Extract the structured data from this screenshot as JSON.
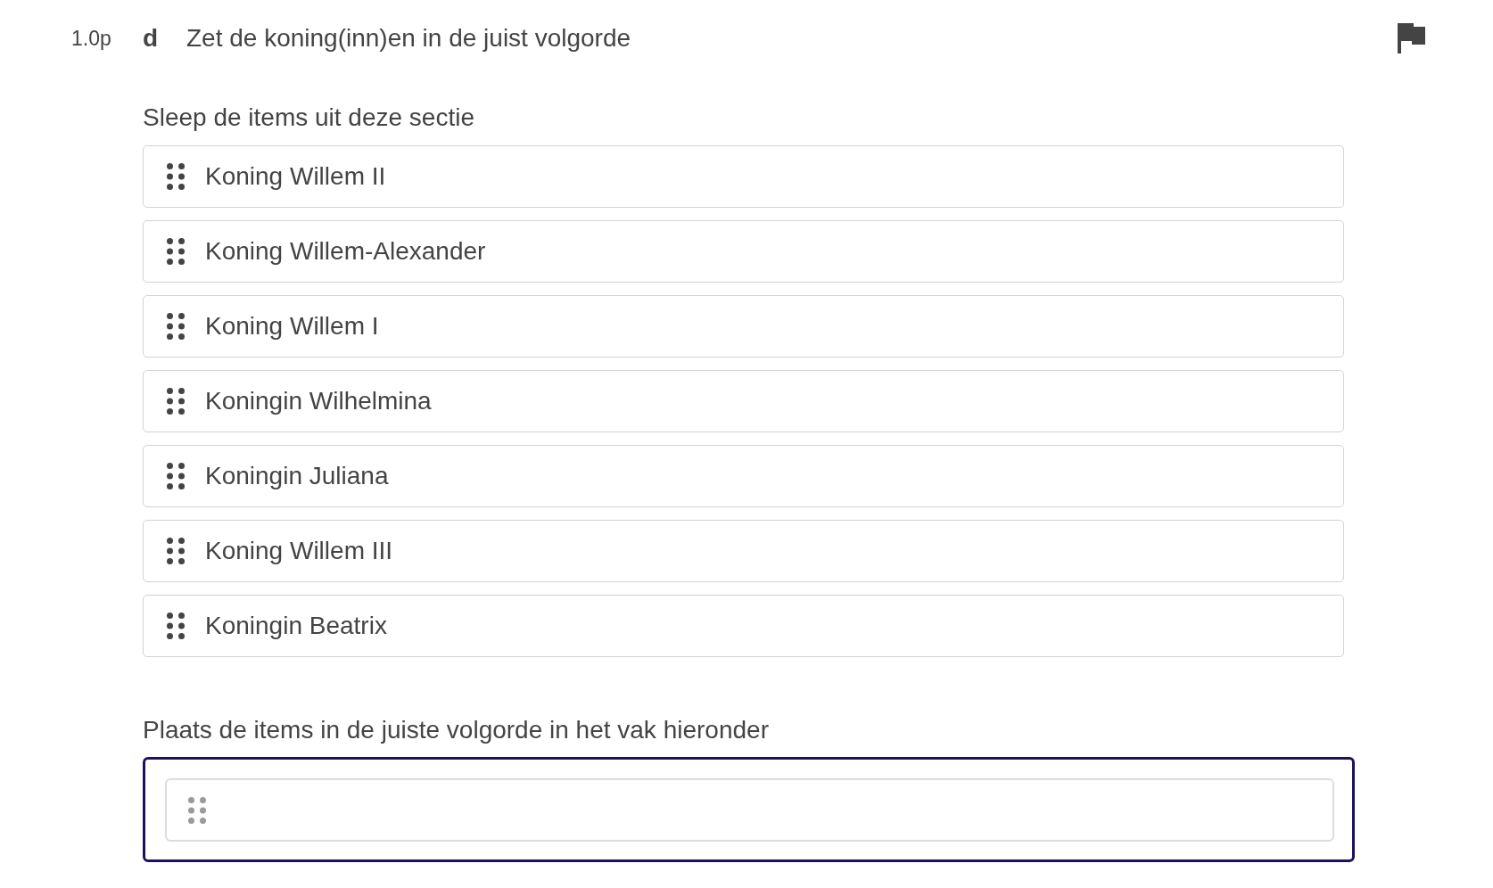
{
  "question": {
    "points": "1.0p",
    "letter": "d",
    "text": "Zet de koning(inn)en in de juist volgorde"
  },
  "source": {
    "label": "Sleep de items uit deze sectie",
    "items": [
      {
        "label": "Koning Willem II"
      },
      {
        "label": "Koning Willem-Alexander"
      },
      {
        "label": "Koning Willem I"
      },
      {
        "label": "Koningin Wilhelmina"
      },
      {
        "label": "Koningin Juliana"
      },
      {
        "label": "Koning Willem III"
      },
      {
        "label": "Koningin Beatrix"
      }
    ]
  },
  "target": {
    "label": "Plaats de items in de juiste volgorde in het vak hieronder",
    "focused": true,
    "slots": [
      {
        "kind": "placeholder"
      }
    ]
  }
}
